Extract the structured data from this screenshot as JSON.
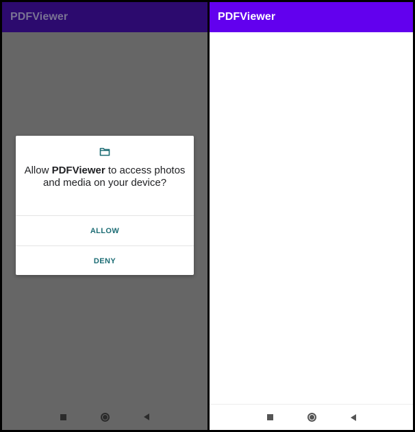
{
  "colors": {
    "appbar_active": "#6200ee",
    "appbar_dimmed": "#2c0a6e",
    "scrim": "#666666",
    "dialog_button": "#1a6b73",
    "dialog_icon": "#1a6b73"
  },
  "left_screen": {
    "app_title": "PDFViewer",
    "dialog": {
      "icon": "folder-icon",
      "message_prefix": "Allow ",
      "message_app": "PDFViewer",
      "message_suffix": " to access photos and media on your device?",
      "allow_label": "ALLOW",
      "deny_label": "DENY"
    },
    "nav": {
      "recents": "square-icon",
      "home": "circle-icon",
      "back": "triangle-back-icon"
    }
  },
  "right_screen": {
    "app_title": "PDFViewer",
    "nav": {
      "recents": "square-icon",
      "home": "circle-icon",
      "back": "triangle-back-icon"
    }
  }
}
